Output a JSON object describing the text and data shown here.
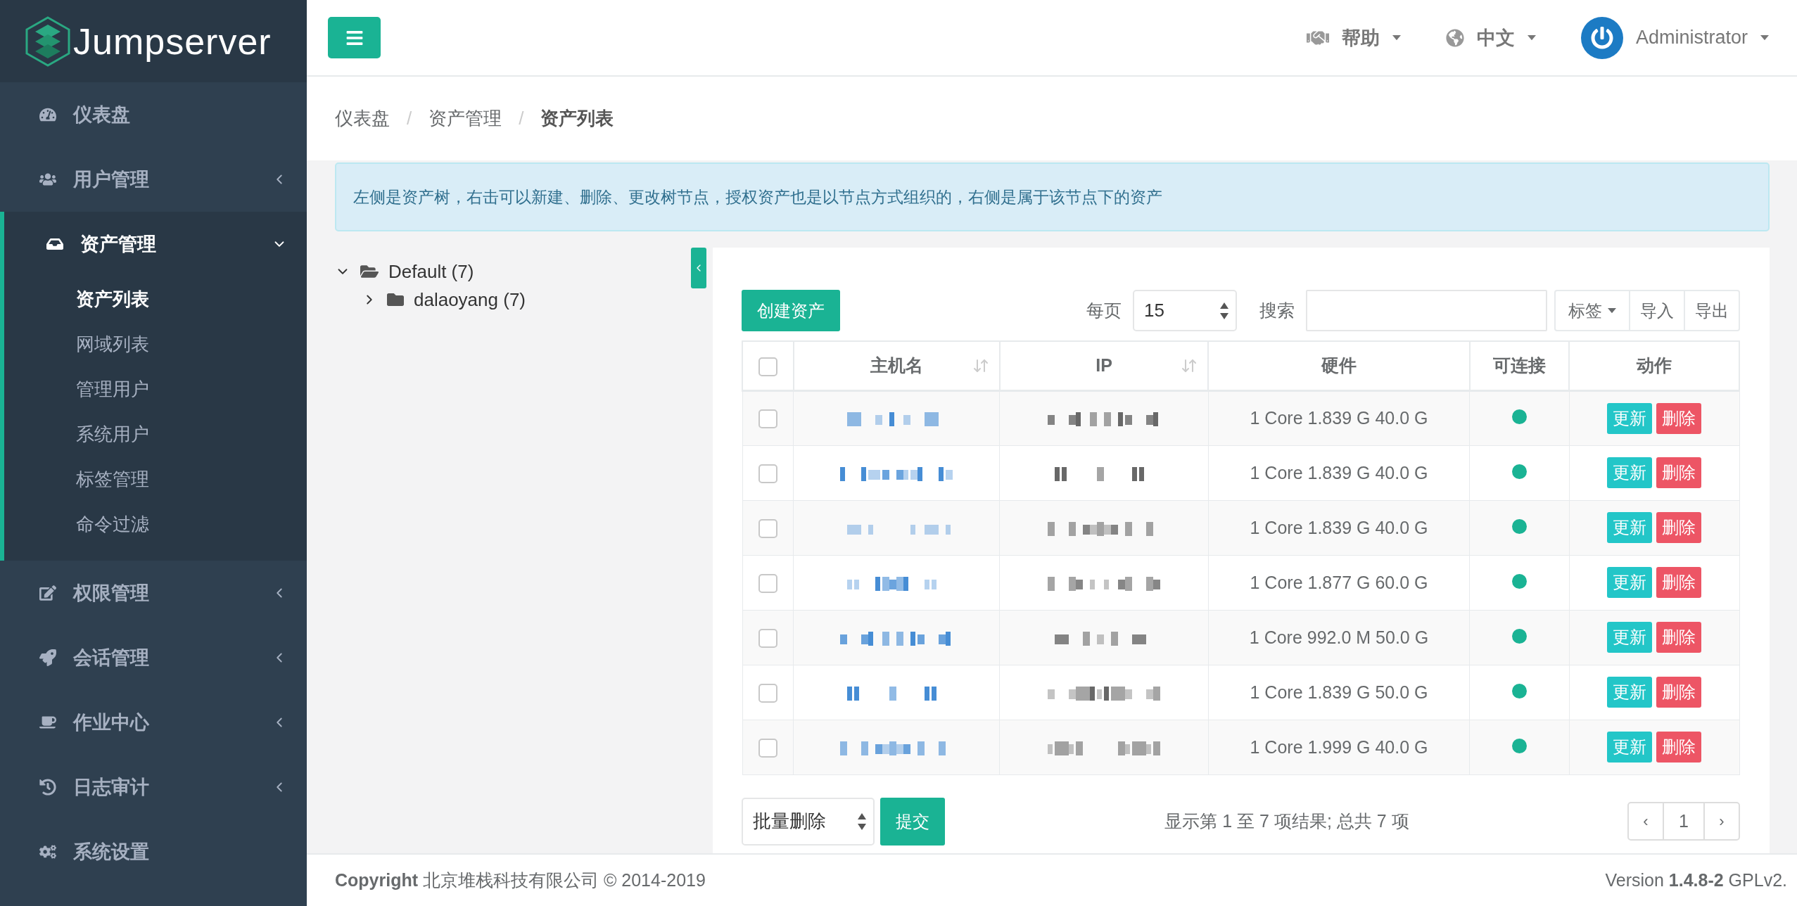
{
  "header": {
    "help": "帮助",
    "language": "中文",
    "user": "Administrator"
  },
  "sidebar": {
    "logo": "Jumpserver",
    "items": [
      {
        "label": "仪表盘",
        "expandable": false,
        "expanded": false,
        "selected": false
      },
      {
        "label": "用户管理",
        "expandable": true,
        "expanded": false,
        "selected": false
      },
      {
        "label": "资产管理",
        "expandable": true,
        "expanded": true,
        "selected": true,
        "children": [
          {
            "label": "资产列表",
            "selected": true
          },
          {
            "label": "网域列表",
            "selected": false
          },
          {
            "label": "管理用户",
            "selected": false
          },
          {
            "label": "系统用户",
            "selected": false
          },
          {
            "label": "标签管理",
            "selected": false
          },
          {
            "label": "命令过滤",
            "selected": false
          }
        ]
      },
      {
        "label": "权限管理",
        "expandable": true,
        "expanded": false,
        "selected": false
      },
      {
        "label": "会话管理",
        "expandable": true,
        "expanded": false,
        "selected": false
      },
      {
        "label": "作业中心",
        "expandable": true,
        "expanded": false,
        "selected": false
      },
      {
        "label": "日志审计",
        "expandable": true,
        "expanded": false,
        "selected": false
      },
      {
        "label": "系统设置",
        "expandable": false,
        "expanded": false,
        "selected": false
      }
    ]
  },
  "breadcrumb": {
    "separator": "/",
    "items": [
      {
        "label": "仪表盘",
        "current": false
      },
      {
        "label": "资产管理",
        "current": false
      },
      {
        "label": "资产列表",
        "current": true
      }
    ]
  },
  "alert": "左侧是资产树，右击可以新建、删除、更改树节点，授权资产也是以节点方式组织的，右侧是属于该节点下的资产",
  "tree": [
    {
      "label": "Default (7)",
      "expanded": true,
      "children": [
        {
          "label": "dalaoyang (7)",
          "expanded": false
        }
      ]
    }
  ],
  "toolbar": {
    "create_button": "创建资产",
    "per_page_label": "每页",
    "per_page": "15",
    "search_label": "搜索",
    "tag_button": "标签",
    "import_button": "导入",
    "export_button": "导出"
  },
  "table": {
    "select_all": {
      "checked": false
    },
    "columns": [
      {
        "label": "主机名",
        "sortable": true
      },
      {
        "label": "IP",
        "sortable": true
      },
      {
        "label": "硬件",
        "sortable": false
      },
      {
        "label": "可连接",
        "sortable": false
      },
      {
        "label": "动作",
        "sortable": false
      }
    ],
    "rows": [
      {
        "checked": false,
        "hardware": "1 Core 1.839 G 40.0 G",
        "connectable": true,
        "actions": [
          {
            "kind": "update",
            "label": "更新"
          },
          {
            "kind": "delete",
            "label": "删除"
          }
        ]
      },
      {
        "checked": false,
        "hardware": "1 Core 1.839 G 40.0 G",
        "connectable": true,
        "actions": [
          {
            "kind": "update",
            "label": "更新"
          },
          {
            "kind": "delete",
            "label": "删除"
          }
        ]
      },
      {
        "checked": false,
        "hardware": "1 Core 1.839 G 40.0 G",
        "connectable": true,
        "actions": [
          {
            "kind": "update",
            "label": "更新"
          },
          {
            "kind": "delete",
            "label": "删除"
          }
        ]
      },
      {
        "checked": false,
        "hardware": "1 Core 1.877 G 60.0 G",
        "connectable": true,
        "actions": [
          {
            "kind": "update",
            "label": "更新"
          },
          {
            "kind": "delete",
            "label": "删除"
          }
        ]
      },
      {
        "checked": false,
        "hardware": "1 Core 992.0 M 50.0 G",
        "connectable": true,
        "actions": [
          {
            "kind": "update",
            "label": "更新"
          },
          {
            "kind": "delete",
            "label": "删除"
          }
        ]
      },
      {
        "checked": false,
        "hardware": "1 Core 1.839 G 50.0 G",
        "connectable": true,
        "actions": [
          {
            "kind": "update",
            "label": "更新"
          },
          {
            "kind": "delete",
            "label": "删除"
          }
        ]
      },
      {
        "checked": false,
        "hardware": "1 Core 1.999 G 40.0 G",
        "connectable": true,
        "actions": [
          {
            "kind": "update",
            "label": "更新"
          },
          {
            "kind": "delete",
            "label": "删除"
          }
        ]
      }
    ]
  },
  "bulk": {
    "action": "批量删除",
    "submit": "提交"
  },
  "summary": "显示第 1 至 7 项结果; 总共 7 项",
  "pagination": {
    "prev": "‹",
    "pages": [
      "1"
    ],
    "next": "›"
  },
  "footer": {
    "copyright": "**Copyright** 北京堆栈科技有限公司 © 2014-2019",
    "version": "Version **1.4.8-2** GPLv2."
  }
}
